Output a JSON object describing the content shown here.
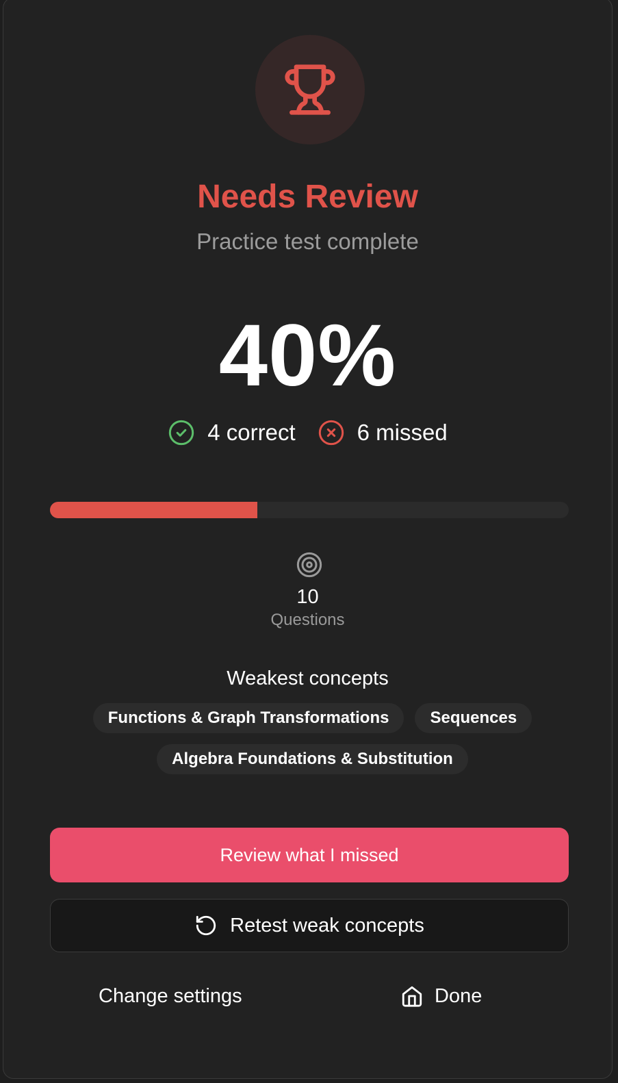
{
  "result": {
    "title": "Needs Review",
    "subtitle": "Practice test complete",
    "score": "40%",
    "correct_label": "4 correct",
    "missed_label": "6 missed",
    "progress_fraction": 0.4
  },
  "summary": {
    "question_count": "10",
    "question_label": "Questions"
  },
  "weakest": {
    "title": "Weakest concepts",
    "concepts": [
      "Functions & Graph Transformations",
      "Sequences",
      "Algebra Foundations & Substitution"
    ]
  },
  "actions": {
    "review_label": "Review what I missed",
    "retest_label": "Retest weak concepts",
    "settings_label": "Change settings",
    "done_label": "Done"
  },
  "icons": {
    "trophy": "trophy-icon",
    "correct": "check-circle-icon",
    "missed": "x-circle-icon",
    "questions": "target-icon",
    "retest": "rotate-ccw-icon",
    "done": "home-icon"
  },
  "colors": {
    "accent_red": "#e0534a",
    "primary_button": "#ea4e6b",
    "correct_green": "#5cbe6a",
    "background": "#222222"
  }
}
